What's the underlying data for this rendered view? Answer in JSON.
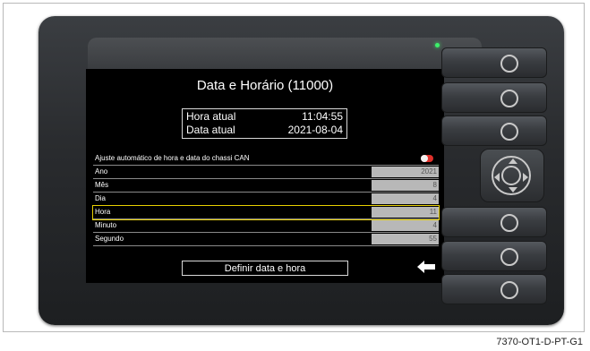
{
  "screen": {
    "title": "Data e Horário (11000)",
    "current": {
      "time_label": "Hora atual",
      "time_value": "11:04:55",
      "date_label": "Data atual",
      "date_value": "2021-08-04"
    },
    "auto_sync": {
      "label": "Ajuste automático de hora e data do chassi CAN",
      "enabled": false
    },
    "fields": [
      {
        "label": "Ano",
        "value": "2021"
      },
      {
        "label": "Mês",
        "value": "8"
      },
      {
        "label": "Dia",
        "value": "4"
      },
      {
        "label": "Hora",
        "value": "11",
        "selected": true
      },
      {
        "label": "Minuto",
        "value": "4"
      },
      {
        "label": "Segundo",
        "value": "55"
      }
    ],
    "action_label": "Definir data e hora",
    "back_icon": "arrow-left-icon"
  },
  "device": {
    "buttons": [
      "soft-key-1",
      "soft-key-2",
      "soft-key-3",
      "soft-key-4",
      "soft-key-5",
      "soft-key-6"
    ],
    "dpad_icon": "dpad-icon",
    "led_color": "#3cf06a",
    "highlight_color": "#e8d000",
    "toggle_color": "#e0302a"
  },
  "figure_id": "7370-OT1-D-PT-G1"
}
